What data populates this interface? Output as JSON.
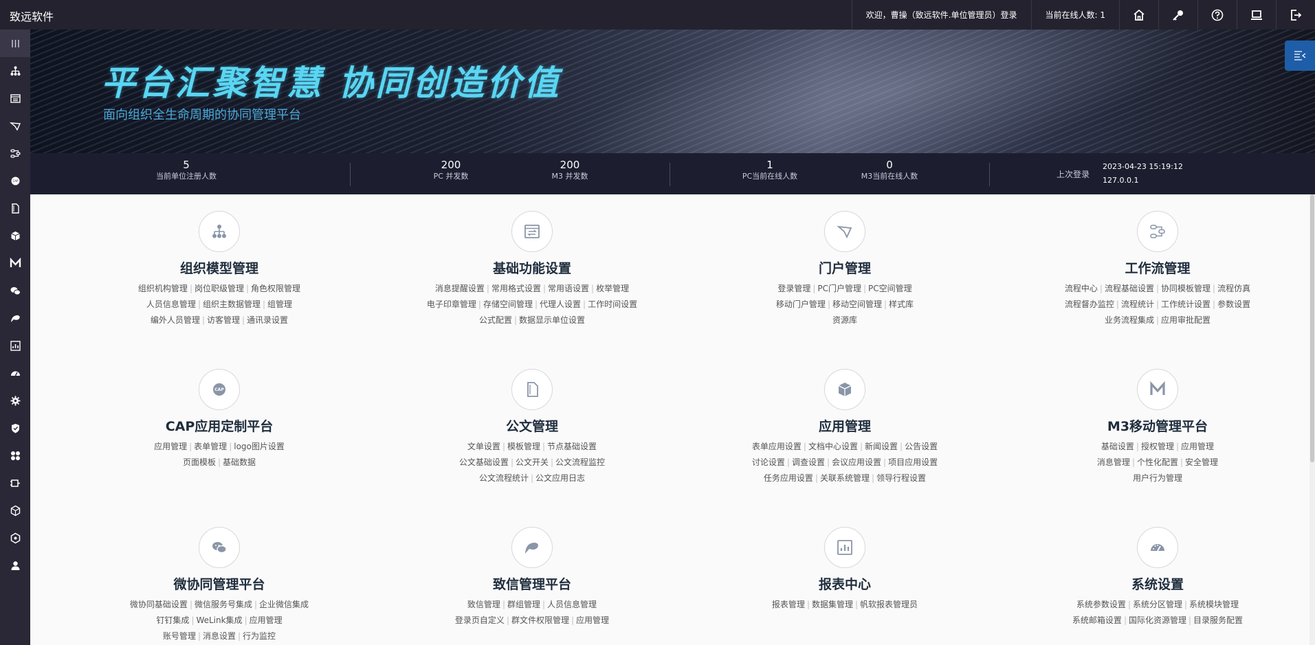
{
  "header": {
    "brand": "致远软件",
    "welcome": "欢迎，曹操（致远软件.单位管理员）登录",
    "online": "当前在线人数: 1",
    "icons": [
      "home-icon",
      "key-icon",
      "help-icon",
      "desktop-icon",
      "logout-icon"
    ]
  },
  "sidebar": {
    "icons": [
      "menu-icon",
      "org-icon",
      "form-icon",
      "portal-icon",
      "workflow-icon",
      "cap-icon",
      "document-icon",
      "cube-icon",
      "m3-icon",
      "wechat-icon",
      "zhixin-icon",
      "report-icon",
      "dashboard-icon",
      "gear-icon",
      "shield-icon",
      "apps-icon",
      "plugin-icon",
      "hexagon-icon",
      "hexagon-alt-icon",
      "user-icon"
    ]
  },
  "banner": {
    "slogan": "平台汇聚智慧 协同创造价值",
    "subtitle": "面向组织全生命周期的协同管理平台"
  },
  "stats": {
    "registered": {
      "value": "5",
      "label": "当前单位注册人数"
    },
    "pc_concurrent": {
      "value": "200",
      "label": "PC 并发数"
    },
    "m3_concurrent": {
      "value": "200",
      "label": "M3 并发数"
    },
    "pc_online": {
      "value": "1",
      "label": "PC当前在线人数"
    },
    "m3_online": {
      "value": "0",
      "label": "M3当前在线人数"
    },
    "last_login_label": "上次登录",
    "last_login_time": "2023-04-23 15:19:12",
    "last_login_ip": "127.0.0.1"
  },
  "modules": [
    {
      "title": "组织模型管理",
      "icon": "org-icon",
      "lines": [
        [
          "组织机构管理",
          "岗位职级管理",
          "角色权限管理"
        ],
        [
          "人员信息管理",
          "组织主数据管理",
          "组管理"
        ],
        [
          "编外人员管理",
          "访客管理",
          "通讯录设置"
        ]
      ]
    },
    {
      "title": "基础功能设置",
      "icon": "form-icon",
      "lines": [
        [
          "消息提醒设置",
          "常用格式设置",
          "常用语设置",
          "枚举管理"
        ],
        [
          "电子印章管理",
          "存储空间管理",
          "代理人设置",
          "工作时间设置"
        ],
        [
          "公式配置",
          "数据显示单位设置"
        ]
      ]
    },
    {
      "title": "门户管理",
      "icon": "portal-icon",
      "lines": [
        [
          "登录管理",
          "PC门户管理",
          "PC空间管理"
        ],
        [
          "移动门户管理",
          "移动空间管理",
          "样式库"
        ],
        [
          "资源库"
        ]
      ]
    },
    {
      "title": "工作流管理",
      "icon": "workflow-icon",
      "lines": [
        [
          "流程中心",
          "流程基础设置",
          "协同模板管理",
          "流程仿真"
        ],
        [
          "流程督办监控",
          "流程统计",
          "工作统计设置",
          "参数设置"
        ],
        [
          "业务流程集成",
          "应用审批配置"
        ]
      ]
    },
    {
      "title": "CAP应用定制平台",
      "icon": "cap-icon",
      "lines": [
        [
          "应用管理",
          "表单管理",
          "logo图片设置"
        ],
        [
          "页面模板",
          "基础数据"
        ]
      ]
    },
    {
      "title": "公文管理",
      "icon": "document-icon",
      "lines": [
        [
          "文单设置",
          "模板管理",
          "节点基础设置"
        ],
        [
          "公文基础设置",
          "公文开关",
          "公文流程监控"
        ],
        [
          "公文流程统计",
          "公文应用日志"
        ]
      ]
    },
    {
      "title": "应用管理",
      "icon": "cube-icon",
      "lines": [
        [
          "表单应用设置",
          "文档中心设置",
          "新闻设置",
          "公告设置"
        ],
        [
          "讨论设置",
          "调查设置",
          "会议应用设置",
          "项目应用设置"
        ],
        [
          "任务应用设置",
          "关联系统管理",
          "领导行程设置"
        ]
      ]
    },
    {
      "title": "M3移动管理平台",
      "icon": "m3-icon",
      "lines": [
        [
          "基础设置",
          "授权管理",
          "应用管理"
        ],
        [
          "消息管理",
          "个性化配置",
          "安全管理"
        ],
        [
          "用户行为管理"
        ]
      ]
    },
    {
      "title": "微协同管理平台",
      "icon": "wechat-icon",
      "lines": [
        [
          "微协同基础设置",
          "微信服务号集成",
          "企业微信集成"
        ],
        [
          "钉钉集成",
          "WeLink集成",
          "应用管理"
        ],
        [
          "账号管理",
          "消息设置",
          "行为监控"
        ]
      ]
    },
    {
      "title": "致信管理平台",
      "icon": "zhixin-icon",
      "lines": [
        [
          "致信管理",
          "群组管理",
          "人员信息管理"
        ],
        [
          "登录页自定义",
          "群文件权限管理",
          "应用管理"
        ]
      ]
    },
    {
      "title": "报表中心",
      "icon": "report-icon",
      "lines": [
        [
          "报表管理",
          "数据集管理",
          "帆软报表管理员"
        ]
      ]
    },
    {
      "title": "系统设置",
      "icon": "dashboard-icon",
      "lines": [
        [
          "系统参数设置",
          "系统分区管理",
          "系统模块管理"
        ],
        [
          "系统邮箱设置",
          "国际化资源管理",
          "目录服务配置"
        ]
      ]
    }
  ]
}
